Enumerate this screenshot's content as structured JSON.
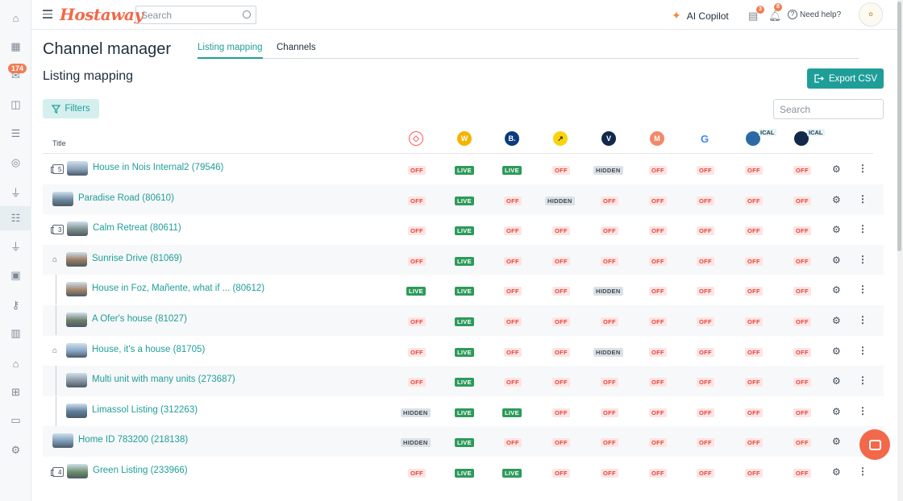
{
  "app": {
    "logo": "Hostaway",
    "search_placeholder": "Search"
  },
  "sidebar": {
    "inbox_badge": "174",
    "items": [
      "home-icon",
      "calendar-icon",
      "inbox-icon",
      "reservations-icon",
      "list-icon",
      "money-icon",
      "plug-icon",
      "channel-manager-icon",
      "plug-icon",
      "briefcase-icon",
      "key-icon",
      "chart-icon",
      "house-icon",
      "sitemap-icon",
      "layout-icon",
      "gear-icon"
    ]
  },
  "topbar": {
    "copilot_label": "AI Copilot",
    "tasks_badge": "3",
    "notif_badge": "8",
    "help_label": "Need help?"
  },
  "page": {
    "title": "Channel manager",
    "subtitle": "Listing mapping",
    "export_label": "Export CSV",
    "filters_label": "Filters",
    "search_placeholder": "Search"
  },
  "tabs": [
    {
      "label": "Listing mapping",
      "active": true
    },
    {
      "label": "Channels",
      "active": false
    }
  ],
  "table": {
    "title_header": "Title",
    "channels": [
      {
        "name": "airbnb",
        "glyph": "",
        "color": "#ff5a5f"
      },
      {
        "name": "w-channel",
        "glyph": "W",
        "color": "#f5b400"
      },
      {
        "name": "booking",
        "glyph": "B.",
        "color": "#0c3b7c"
      },
      {
        "name": "expedia",
        "glyph": "↗",
        "color": "#fcd20b"
      },
      {
        "name": "vrbo",
        "glyph": "V",
        "color": "#13294b"
      },
      {
        "name": "m-channel",
        "glyph": "M",
        "color": "#f2896a"
      },
      {
        "name": "google",
        "glyph": "G",
        "color": "#ffffff"
      },
      {
        "name": "ical-1",
        "glyph": "",
        "color": "#2c6aa5",
        "ical": "ICAL"
      },
      {
        "name": "ical-2",
        "glyph": "",
        "color": "#13294b",
        "ical": "ICAL"
      }
    ],
    "rows": [
      {
        "title": "House in Nois Internal2 (79546)",
        "group_count": "5",
        "statuses": [
          "OFF",
          "LIVE",
          "LIVE",
          "OFF",
          "HIDDEN",
          "OFF",
          "OFF",
          "OFF",
          "OFF"
        ]
      },
      {
        "title": "Paradise Road (80610)",
        "statuses": [
          "OFF",
          "LIVE",
          "OFF",
          "HIDDEN",
          "OFF",
          "OFF",
          "OFF",
          "OFF",
          "OFF"
        ]
      },
      {
        "title": "Calm Retreat (80611)",
        "group_count": "3",
        "statuses": [
          "OFF",
          "LIVE",
          "OFF",
          "OFF",
          "OFF",
          "OFF",
          "OFF",
          "OFF",
          "OFF"
        ]
      },
      {
        "title": "Sunrise Drive (81069)",
        "home": true,
        "statuses": [
          "OFF",
          "LIVE",
          "OFF",
          "OFF",
          "OFF",
          "OFF",
          "OFF",
          "OFF",
          "OFF"
        ]
      },
      {
        "title": "House in Foz, Mañente, what if ... (80612)",
        "child": true,
        "statuses": [
          "LIVE",
          "LIVE",
          "OFF",
          "OFF",
          "HIDDEN",
          "OFF",
          "OFF",
          "OFF",
          "OFF"
        ]
      },
      {
        "title": "A Ofer's house (81027)",
        "child": true,
        "statuses": [
          "OFF",
          "LIVE",
          "OFF",
          "OFF",
          "OFF",
          "OFF",
          "OFF",
          "OFF",
          "OFF"
        ]
      },
      {
        "title": "House, it's a house (81705)",
        "home": true,
        "statuses": [
          "OFF",
          "LIVE",
          "OFF",
          "OFF",
          "HIDDEN",
          "OFF",
          "OFF",
          "OFF",
          "OFF"
        ]
      },
      {
        "title": "Multi unit with many units (273687)",
        "child": true,
        "statuses": [
          "OFF",
          "LIVE",
          "OFF",
          "OFF",
          "OFF",
          "OFF",
          "OFF",
          "OFF",
          "OFF"
        ]
      },
      {
        "title": "Limassol Listing (312263)",
        "child": true,
        "statuses": [
          "HIDDEN",
          "LIVE",
          "LIVE",
          "OFF",
          "OFF",
          "OFF",
          "OFF",
          "OFF",
          "OFF"
        ]
      },
      {
        "title": "Home ID 783200 (218138)",
        "statuses": [
          "HIDDEN",
          "LIVE",
          "OFF",
          "OFF",
          "OFF",
          "OFF",
          "OFF",
          "OFF",
          "OFF"
        ]
      },
      {
        "title": "Green Listing (233966)",
        "group_count": "4",
        "statuses": [
          "OFF",
          "LIVE",
          "LIVE",
          "OFF",
          "OFF",
          "OFF",
          "OFF",
          "OFF",
          "OFF"
        ]
      }
    ]
  }
}
